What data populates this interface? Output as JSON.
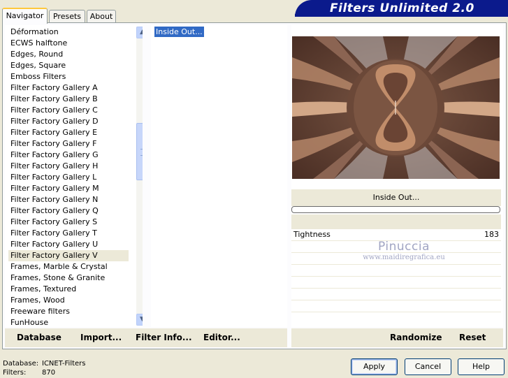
{
  "tabs": [
    {
      "label": "Navigator",
      "active": true
    },
    {
      "label": "Presets",
      "active": false
    },
    {
      "label": "About",
      "active": false
    }
  ],
  "banner": {
    "title": "Filters Unlimited 2.0"
  },
  "categories": [
    "Déformation",
    "ECWS halftone",
    "Edges, Round",
    "Edges, Square",
    "Emboss Filters",
    "Filter Factory Gallery A",
    "Filter Factory Gallery B",
    "Filter Factory Gallery C",
    "Filter Factory Gallery D",
    "Filter Factory Gallery E",
    "Filter Factory Gallery F",
    "Filter Factory Gallery G",
    "Filter Factory Gallery H",
    "Filter Factory Gallery L",
    "Filter Factory Gallery M",
    "Filter Factory Gallery N",
    "Filter Factory Gallery Q",
    "Filter Factory Gallery S",
    "Filter Factory Gallery T",
    "Filter Factory Gallery U",
    "Filter Factory Gallery V",
    "Frames, Marble & Crystal",
    "Frames, Stone & Granite",
    "Frames, Textured",
    "Frames, Wood",
    "Freeware filters",
    "FunHouse"
  ],
  "selected_category": "Filter Factory Gallery V",
  "filters": [
    "Inside Out..."
  ],
  "selected_filter": "Inside Out...",
  "preview": {
    "filter_name": "Inside Out..."
  },
  "parameters": [
    {
      "label": "Tightness",
      "value": "183",
      "level": 0.72
    }
  ],
  "watermark": {
    "line1": "Pinuccia",
    "line2": "www.maidiregrafica.eu"
  },
  "bottom_left_buttons": {
    "database": "Database",
    "import": "Import...",
    "filter_info": "Filter Info...",
    "editor": "Editor..."
  },
  "bottom_right_buttons": {
    "randomize": "Randomize",
    "reset": "Reset"
  },
  "status": {
    "database_label": "Database:",
    "database_value": "ICNET-Filters",
    "filters_label": "Filters:",
    "filters_value": "870"
  },
  "dialog_buttons": {
    "apply": "Apply",
    "cancel": "Cancel",
    "help": "Help"
  },
  "colors": {
    "dialog_bg": "#ece9d8",
    "banner_bg": "#0b1a8c",
    "selection_bg": "#316ac5",
    "preview_dark": "#6b4a3a",
    "preview_light": "#c49a7c"
  }
}
